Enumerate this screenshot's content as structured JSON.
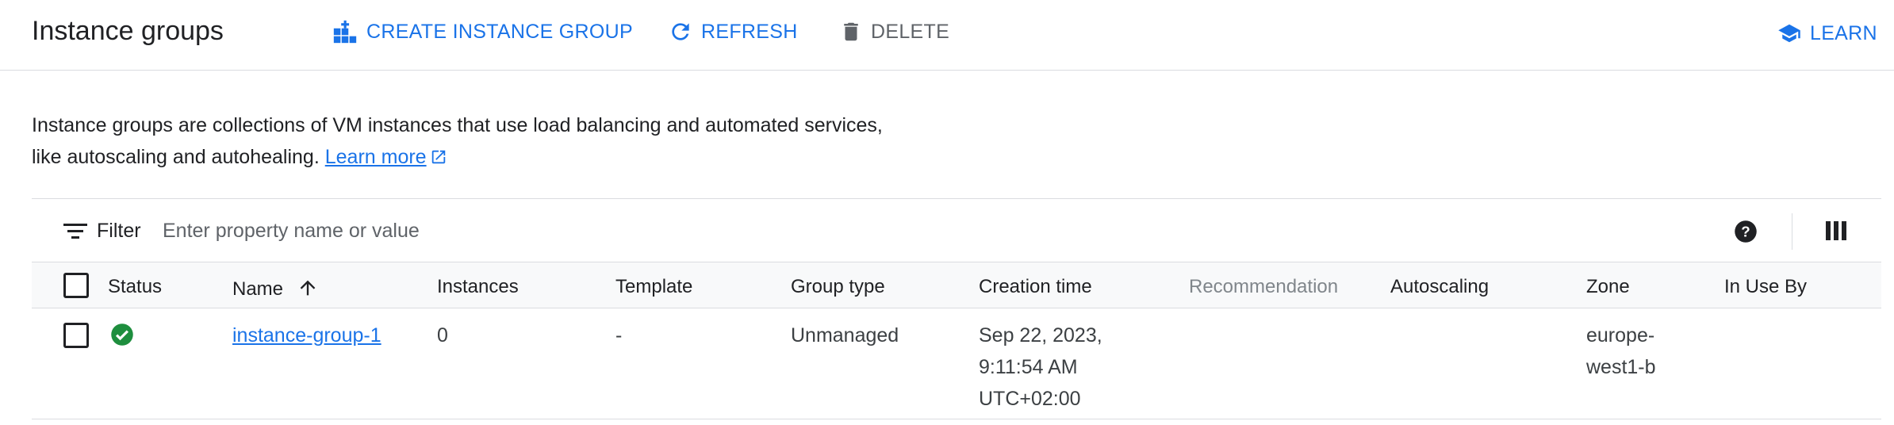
{
  "header": {
    "title": "Instance groups",
    "create_label": "CREATE INSTANCE GROUP",
    "refresh_label": "REFRESH",
    "delete_label": "DELETE",
    "learn_label": "LEARN"
  },
  "description": {
    "text": "Instance groups are collections of VM instances that use load balancing and automated services, like autoscaling and autohealing.",
    "link_label": "Learn more"
  },
  "filter": {
    "label": "Filter",
    "placeholder": "Enter property name or value"
  },
  "table": {
    "columns": {
      "status": "Status",
      "name": "Name",
      "instances": "Instances",
      "template": "Template",
      "group_type": "Group type",
      "creation_time": "Creation time",
      "recommendation": "Recommendation",
      "autoscaling": "Autoscaling",
      "zone": "Zone",
      "in_use_by": "In Use By"
    },
    "sort": {
      "column": "Name",
      "direction": "ascending"
    },
    "rows": [
      {
        "status": "ok",
        "name": "instance-group-1",
        "instances": "0",
        "template": "-",
        "group_type": "Unmanaged",
        "creation_time_line1": "Sep 22, 2023,",
        "creation_time_line2": "9:11:54 AM",
        "creation_time_line3": "UTC+02:00",
        "recommendation": "",
        "autoscaling": "",
        "zone_line1": "europe-",
        "zone_line2": "west1-b",
        "in_use_by": ""
      }
    ]
  },
  "colors": {
    "accent": "#1a73e8",
    "status_ok": "#1e8e3e",
    "border": "#dadce0",
    "muted": "#5f6368"
  }
}
